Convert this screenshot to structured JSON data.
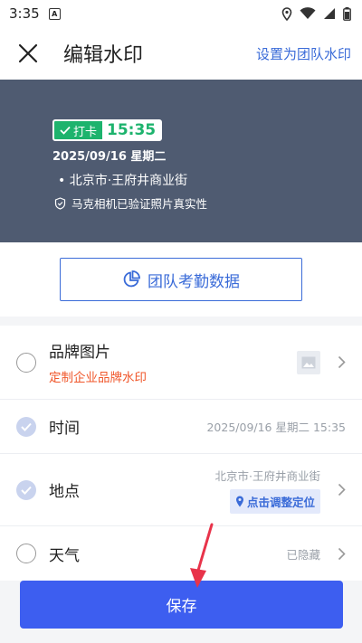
{
  "status_bar": {
    "time": "3:35",
    "notif_icon": "A"
  },
  "header": {
    "title": "编辑水印",
    "action": "设置为团队水印"
  },
  "watermark": {
    "badge_label": "打卡",
    "time": "15:35",
    "date": "2025/09/16 星期二",
    "location": "北京市·王府井商业街",
    "verify_text": "马克相机已验证照片真实性"
  },
  "team_button": {
    "label": "团队考勤数据"
  },
  "options": [
    {
      "label": "品牌图片",
      "sub": "定制企业品牌水印",
      "checked": false
    },
    {
      "label": "时间",
      "value": "2025/09/16 星期二 15:35",
      "checked": true
    },
    {
      "label": "地点",
      "value": "北京市·王府井商业街",
      "action": "点击调整定位",
      "checked": true
    },
    {
      "label": "天气",
      "value": "已隐藏",
      "checked": false
    }
  ],
  "save_button": {
    "label": "保存"
  },
  "colors": {
    "accent": "#3a6bd8",
    "save": "#3d5ef0",
    "badge_green": "#1db36d",
    "preview_bg": "#4f5b71",
    "brand_sub": "#f0572b",
    "annotation_arrow": "#e8334a"
  }
}
